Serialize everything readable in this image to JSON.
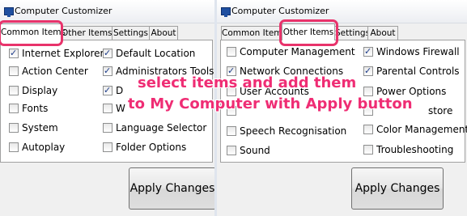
{
  "app_title": "Computer Customizer",
  "accent_highlight_color": "#e8336b",
  "annotation_color": "#ef2d74",
  "annotation": {
    "line1": "select items and add them",
    "line2": "to My Computer with Apply button"
  },
  "window_left": {
    "tabs": [
      {
        "label": "Common Items",
        "active": true
      },
      {
        "label": "Other Items",
        "active": false
      },
      {
        "label": "Settings",
        "active": false
      },
      {
        "label": "About",
        "active": false
      }
    ],
    "items": [
      {
        "label": "Internet Explorer",
        "checked": true
      },
      {
        "label": "Default Location",
        "checked": true
      },
      {
        "label": "Action Center",
        "checked": false
      },
      {
        "label": "Administrators Tools",
        "checked": true
      },
      {
        "label": "Display",
        "checked": false
      },
      {
        "label": "D",
        "checked": true
      },
      {
        "label": "Fonts",
        "checked": false
      },
      {
        "label": "W",
        "checked": false
      },
      {
        "label": "System",
        "checked": false
      },
      {
        "label": "Language Selector",
        "checked": false
      },
      {
        "label": "Autoplay",
        "checked": false
      },
      {
        "label": "Folder Options",
        "checked": false
      }
    ],
    "apply_label": "Apply Changes"
  },
  "window_right": {
    "tabs": [
      {
        "label": "Common Items",
        "active": false
      },
      {
        "label": "Other Items",
        "active": true
      },
      {
        "label": "Settings",
        "active": false
      },
      {
        "label": "About",
        "active": false
      }
    ],
    "items": [
      {
        "label": "Computer Management",
        "checked": false
      },
      {
        "label": "Windows Firewall",
        "checked": true
      },
      {
        "label": "Network Connections",
        "checked": true
      },
      {
        "label": "Parental Controls",
        "checked": true
      },
      {
        "label": "User Accounts",
        "checked": false
      },
      {
        "label": "Power Options",
        "checked": false
      },
      {
        "label": "",
        "checked": false
      },
      {
        "label": "store",
        "checked": false
      },
      {
        "label": "Speech Recognisation",
        "checked": false
      },
      {
        "label": "Color Management",
        "checked": false
      },
      {
        "label": "Sound",
        "checked": false
      },
      {
        "label": "Troubleshooting",
        "checked": false
      }
    ],
    "apply_label": "Apply Changes"
  }
}
